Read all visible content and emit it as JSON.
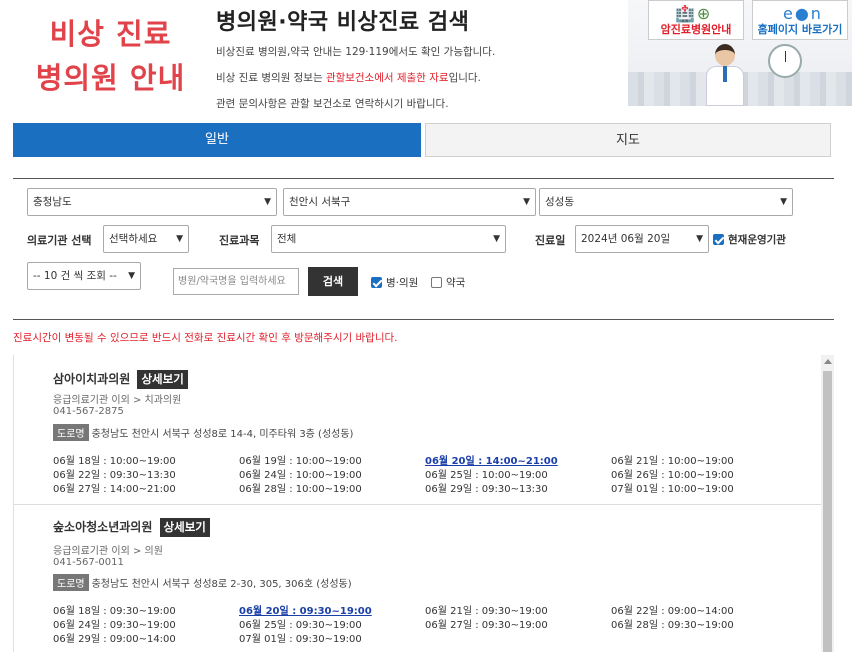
{
  "header": {
    "logo_line1": "비상 진료",
    "logo_line2": "병의원 안내",
    "title": "병의원·약국 비상진료 검색",
    "desc1": "비상진료 병의원,약국 안내는 129·119에서도 확인 가능합니다.",
    "desc2_prefix": "비상 진료 병의원 정보는 ",
    "desc2_red": "관할보건소에서 제출한 자료",
    "desc2_suffix": "입니다.",
    "desc3": "관련 문의사항은 관할 보건소로 연락하시기 바랍니다.",
    "banner_btn1": "암진료병원안내",
    "banner_btn2": "홈페이지 바로가기"
  },
  "tabs": {
    "general": "일반",
    "map": "지도"
  },
  "filters": {
    "province": "충청남도",
    "city": "천안시 서북구",
    "dong": "성성동",
    "inst_label": "의료기관 선택",
    "inst_value": "선택하세요",
    "dept_label": "진료과목",
    "dept_value": "전체",
    "date_label": "진료일",
    "date_value": "2024년 06월 20일",
    "current_label": "현재운영기관",
    "page_size": "-- 10 건 씩 조회 --",
    "search_placeholder": "병원/약국명을 입력하세요",
    "search_button": "검색",
    "hospital_label": "병·의원",
    "pharmacy_label": "약국"
  },
  "notice": "진료시간이 변동될 수 있으므로 반드시 전화로 진료시간 확인 후 방문해주시기 바랍니다.",
  "detail_label": "상세보기",
  "road_tag": "도로명",
  "results": [
    {
      "name": "삼아이치과의원",
      "category": "응급의료기관 이외 > 치과의원",
      "phone": "041-567-2875",
      "address": "충청남도 천안시 서북구 성성8로 14-4, 미주타워 3층 (성성동)",
      "schedule": [
        "06월 18일 : 10:00~19:00",
        "06월 19일 : 10:00~19:00",
        "06월 20일 : 14:00~21:00",
        "06월 21일 : 10:00~19:00",
        "06월 22일 : 09:30~13:30",
        "06월 24일 : 10:00~19:00",
        "06월 25일 : 10:00~19:00",
        "06월 26일 : 10:00~19:00",
        "06월 27일 : 14:00~21:00",
        "06월 28일 : 10:00~19:00",
        "06월 29일 : 09:30~13:30",
        "07월 01일 : 10:00~19:00"
      ]
    },
    {
      "name": "숲소아청소년과의원",
      "category": "응급의료기관 이외 > 의원",
      "phone": "041-567-0011",
      "address": "충청남도 천안시 서북구 성성8로 2-30, 305, 306호 (성성동)",
      "schedule": [
        "06월 18일 : 09:30~19:00",
        "06월 20일 : 09:30~19:00",
        "06월 21일 : 09:30~19:00",
        "06월 22일 : 09:00~14:00",
        "06월 24일 : 09:30~19:00",
        "06월 25일 : 09:30~19:00",
        "06월 27일 : 09:30~19:00",
        "06월 28일 : 09:30~19:00",
        "06월 29일 : 09:00~14:00",
        "07월 01일 : 09:30~19:00"
      ]
    }
  ]
}
